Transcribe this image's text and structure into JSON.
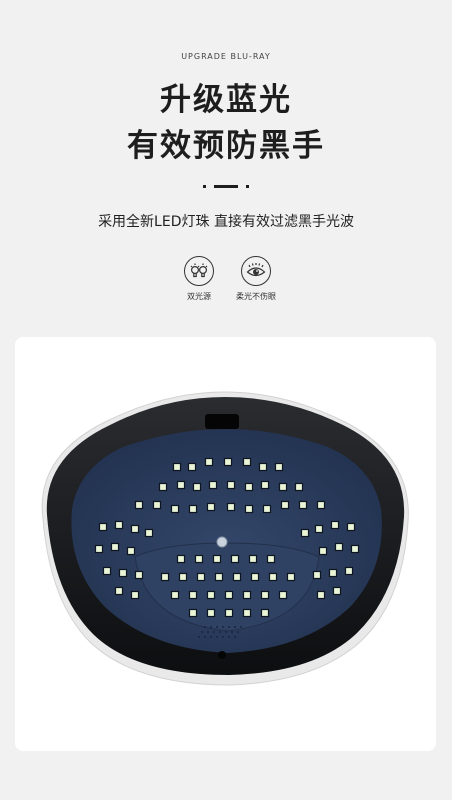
{
  "header": {
    "subtitle_en": "UPGRADE BLU-RAY",
    "title_line1": "升级蓝光",
    "title_line2": "有效预防黑手",
    "description": "采用全新LED灯珠 直接有效过滤黑手光波"
  },
  "features": [
    {
      "icon": "bulbs-icon",
      "label": "双光源"
    },
    {
      "icon": "eye-icon",
      "label": "柔光不伤眼"
    }
  ],
  "product": {
    "name": "nail-uv-led-lamp",
    "colors": {
      "shell": "#16181c",
      "chamber": "#2b3d5c",
      "led": "#e9f5d6",
      "base_ring": "#e7e7e7"
    }
  }
}
